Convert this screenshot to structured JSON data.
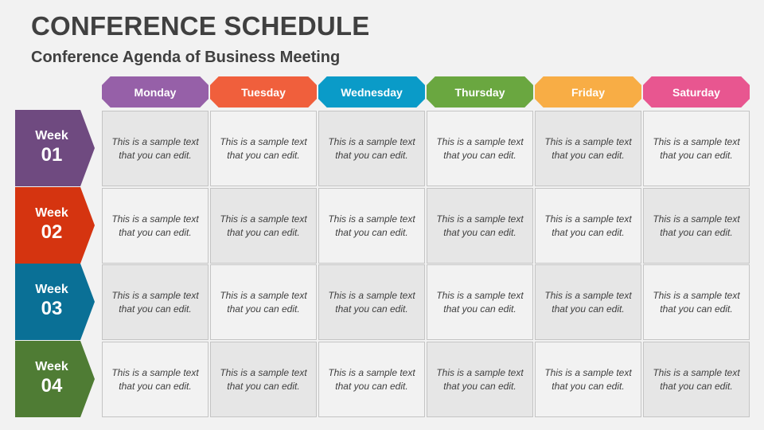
{
  "header": {
    "title": "CONFERENCE SCHEDULE",
    "subtitle": "Conference Agenda of Business Meeting"
  },
  "days": [
    {
      "label": "Monday",
      "color": "#9660a8"
    },
    {
      "label": "Tuesday",
      "color": "#f05f3c"
    },
    {
      "label": "Wednesday",
      "color": "#0a9bc8"
    },
    {
      "label": "Thursday",
      "color": "#6aa740"
    },
    {
      "label": "Friday",
      "color": "#f8ad45"
    },
    {
      "label": "Saturday",
      "color": "#e85690"
    }
  ],
  "weeks": [
    {
      "label": "Week",
      "number": "01",
      "color": "#6f4a80"
    },
    {
      "label": "Week",
      "number": "02",
      "color": "#d53410"
    },
    {
      "label": "Week",
      "number": "03",
      "color": "#0a7096"
    },
    {
      "label": "Week",
      "number": "04",
      "color": "#4f7c34"
    }
  ],
  "cells": [
    [
      "This is a sample text that you can edit.",
      "This is a sample text that you can edit.",
      "This is a sample text that you can edit.",
      "This is a sample text that you can edit.",
      "This is a sample text that you can edit.",
      "This is a sample text that you can edit."
    ],
    [
      "This is a sample text that you can edit.",
      "This is a sample text that you can edit.",
      "This is a sample text that you can edit.",
      "This is a sample text that you can edit.",
      "This is a sample text that you can edit.",
      "This is a sample text that you can edit."
    ],
    [
      "This is a sample text that you can edit.",
      "This is a sample text that you can edit.",
      "This is a sample text that you can edit.",
      "This is a sample text that you can edit.",
      "This is a sample text that you can edit.",
      "This is a sample text that you can edit."
    ],
    [
      "This is a sample text that you can edit.",
      "This is a sample text that you can edit.",
      "This is a sample text that you can edit.",
      "This is a sample text that you can edit.",
      "This is a sample text that you can edit.",
      "This is a sample text that you can edit."
    ]
  ]
}
